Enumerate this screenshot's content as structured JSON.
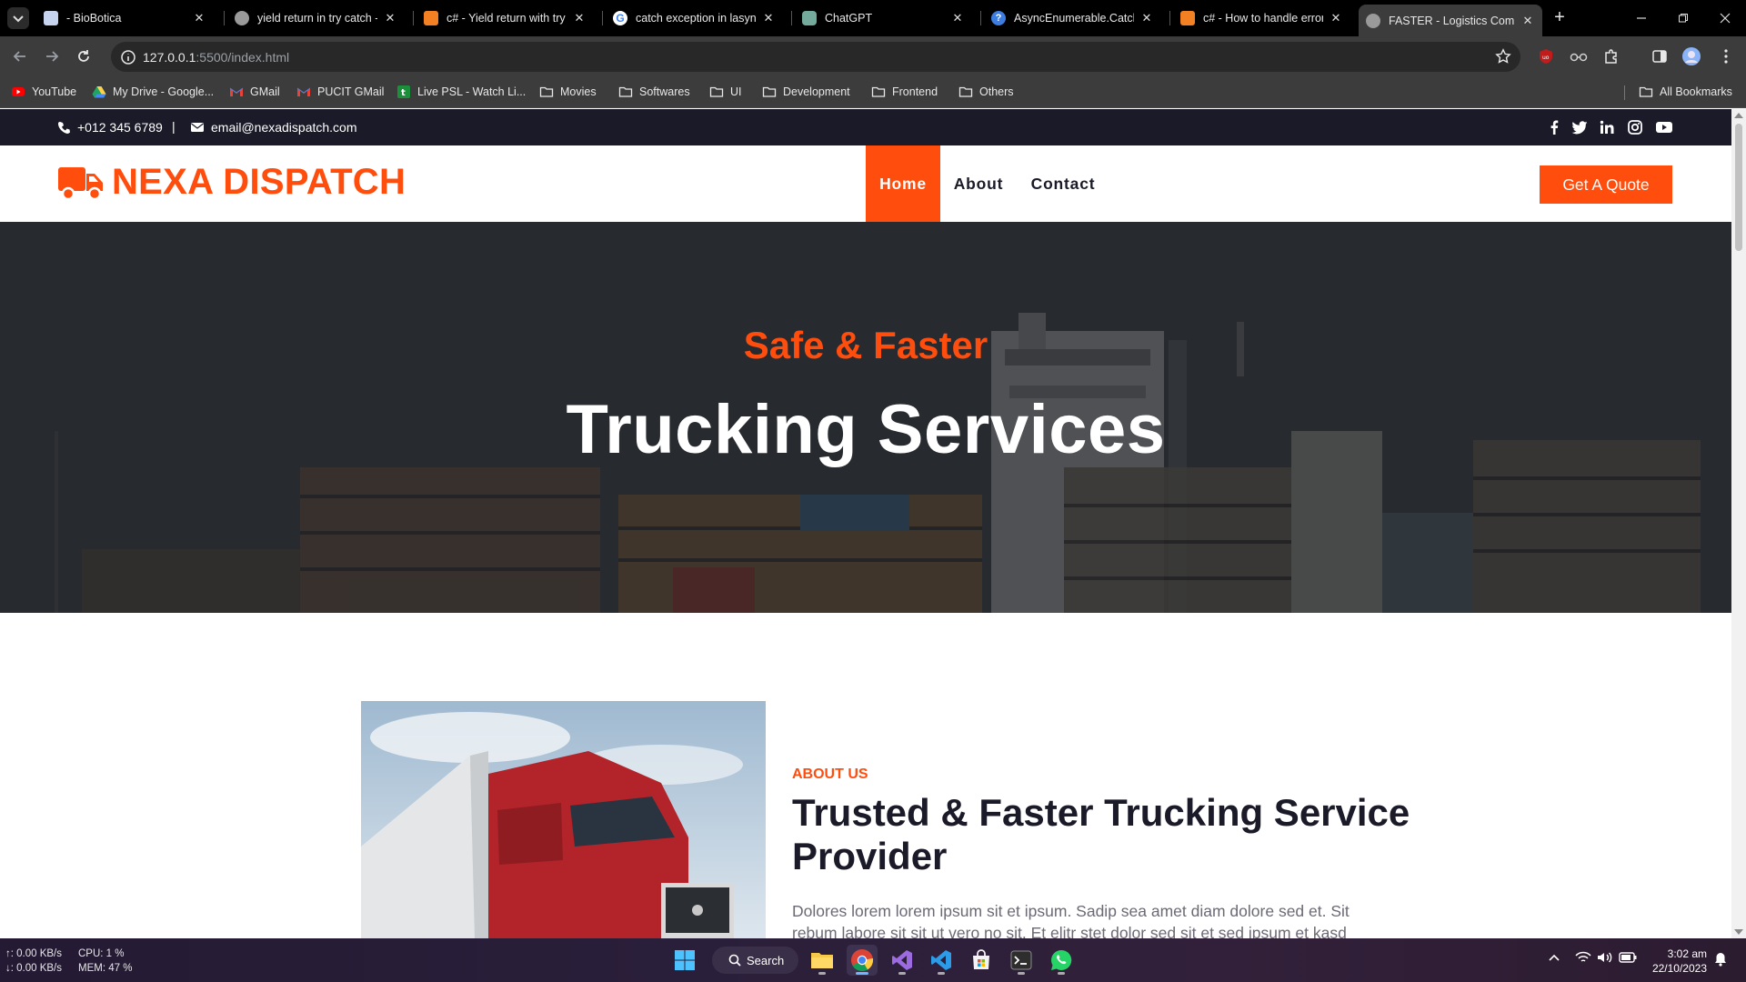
{
  "browser": {
    "tabs": [
      {
        "label": "- BioBotica",
        "icon_color": "#c6d4f0"
      },
      {
        "label": "yield return in try catch -",
        "icon_color": "#9a9a9a"
      },
      {
        "label": "c# - Yield return with try",
        "icon_color": "#f48024"
      },
      {
        "label": "catch exception in lasync",
        "icon_color": "#ffffff"
      },
      {
        "label": "ChatGPT",
        "icon_color": "#74aa9c"
      },
      {
        "label": "AsyncEnumerable.Catch(",
        "icon_color": "#3d7de0"
      },
      {
        "label": "c# - How to handle error",
        "icon_color": "#f48024"
      },
      {
        "label": "FASTER - Logistics Comp",
        "icon_color": "#9a9a9a"
      }
    ],
    "address": {
      "host": "127.0.0.1",
      "path": ":5500/index.html"
    },
    "bookmarks": [
      {
        "label": "YouTube",
        "icon": "youtube-icon"
      },
      {
        "label": "My Drive - Google...",
        "icon": "google-drive-icon"
      },
      {
        "label": "GMail",
        "icon": "gmail-icon"
      },
      {
        "label": "PUCIT GMail",
        "icon": "gmail-icon"
      },
      {
        "label": "Live PSL - Watch Li...",
        "icon": "psl-icon"
      },
      {
        "label": "Movies",
        "icon": "folder-icon"
      },
      {
        "label": "Softwares",
        "icon": "folder-icon"
      },
      {
        "label": "UI",
        "icon": "folder-icon"
      },
      {
        "label": "Development",
        "icon": "folder-icon"
      },
      {
        "label": "Frontend",
        "icon": "folder-icon"
      },
      {
        "label": "Others",
        "icon": "folder-icon"
      }
    ],
    "all_bookmarks": "All Bookmarks"
  },
  "site": {
    "colors": {
      "primary": "#ff4d0d",
      "dark": "#1a1a28"
    },
    "topbar": {
      "phone": "+012 345 6789",
      "divider": "|",
      "email": "email@nexadispatch.com"
    },
    "brand": "NEXA DISPATCH",
    "nav": [
      {
        "label": "Home"
      },
      {
        "label": "About"
      },
      {
        "label": "Contact"
      }
    ],
    "cta": "Get A Quote",
    "hero": {
      "subtitle": "Safe & Faster",
      "title": "Trucking Services"
    },
    "about": {
      "label": "ABOUT US",
      "title": "Trusted & Faster Trucking Service Provider",
      "text": "Dolores lorem lorem ipsum sit et ipsum. Sadip sea amet diam dolore sed et. Sit rebum labore sit sit ut vero no sit. Et elitr stet dolor sed sit et sed ipsum et kasd"
    }
  },
  "taskbar": {
    "net_up": "↑: 0.00 KB/s",
    "net_down": "↓: 0.00 KB/s",
    "cpu": "CPU: 1 %",
    "mem": "MEM: 47 %",
    "search": "Search",
    "time": "3:02 am",
    "date": "22/10/2023"
  }
}
